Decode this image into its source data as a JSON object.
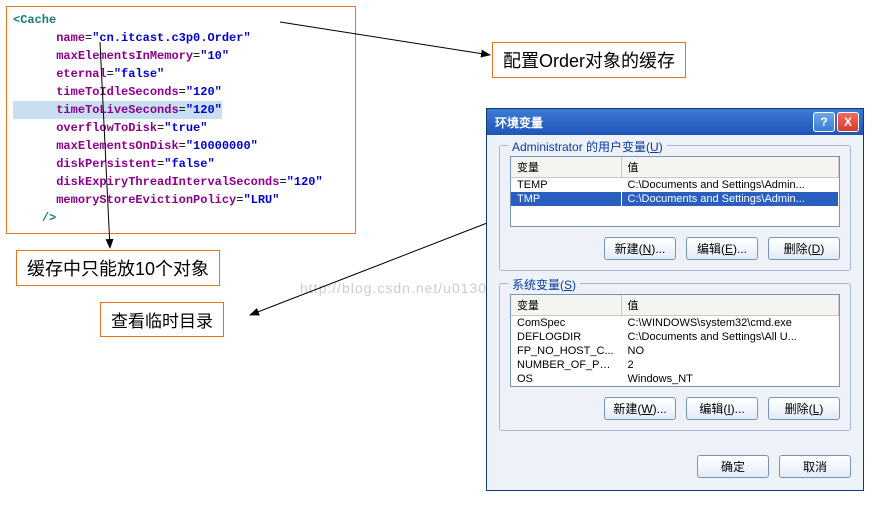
{
  "code": {
    "open_tag": "<Cache",
    "attrs": [
      {
        "name": "name",
        "value": "\"cn.itcast.c3p0.Order\""
      },
      {
        "name": "maxElementsInMemory",
        "value": "\"10\""
      },
      {
        "name": "eternal",
        "value": "\"false\""
      },
      {
        "name": "timeToIdleSeconds",
        "value": "\"120\""
      },
      {
        "name": "timeToLiveSeconds",
        "value": "\"120\""
      },
      {
        "name": "overflowToDisk",
        "value": "\"true\""
      },
      {
        "name": "maxElementsOnDisk",
        "value": "\"10000000\""
      },
      {
        "name": "diskPersistent",
        "value": "\"false\""
      },
      {
        "name": "diskExpiryThreadIntervalSeconds",
        "value": "\"120\""
      },
      {
        "name": "memoryStoreEvictionPolicy",
        "value": "\"LRU\""
      }
    ],
    "close_tag": "/>"
  },
  "annotations": {
    "order_cache": "配置Order对象的缓存",
    "ten_objects": "缓存中只能放10个对象",
    "temp_dir": "查看临时目录"
  },
  "watermark": "http://blog.csdn.net/u013087513",
  "dialog": {
    "title": "环境变量",
    "help": "?",
    "close": "X",
    "user_section": {
      "title_prefix": "Administrator 的用户变量(",
      "title_key": "U",
      "title_suffix": ")",
      "headers": {
        "var": "变量",
        "val": "值"
      },
      "rows": [
        {
          "name": "TEMP",
          "value": "C:\\Documents and Settings\\Admin...",
          "selected": false
        },
        {
          "name": "TMP",
          "value": "C:\\Documents and Settings\\Admin...",
          "selected": true
        }
      ],
      "buttons": {
        "new": {
          "text": "新建(",
          "key": "N",
          "suffix": ")..."
        },
        "edit": {
          "text": "编辑(",
          "key": "E",
          "suffix": ")..."
        },
        "del": {
          "text": "删除(",
          "key": "D",
          "suffix": ")"
        }
      }
    },
    "sys_section": {
      "title_prefix": "系统变量(",
      "title_key": "S",
      "title_suffix": ")",
      "headers": {
        "var": "变量",
        "val": "值"
      },
      "rows": [
        {
          "name": "ComSpec",
          "value": "C:\\WINDOWS\\system32\\cmd.exe"
        },
        {
          "name": "DEFLOGDIR",
          "value": "C:\\Documents and Settings\\All U..."
        },
        {
          "name": "FP_NO_HOST_C...",
          "value": "NO"
        },
        {
          "name": "NUMBER_OF_PR...",
          "value": "2"
        },
        {
          "name": "OS",
          "value": "Windows_NT"
        }
      ],
      "buttons": {
        "new": {
          "text": "新建(",
          "key": "W",
          "suffix": ")..."
        },
        "edit": {
          "text": "编辑(",
          "key": "I",
          "suffix": ")..."
        },
        "del": {
          "text": "删除(",
          "key": "L",
          "suffix": ")"
        }
      }
    },
    "footer": {
      "ok": "确定",
      "cancel": "取消"
    }
  }
}
